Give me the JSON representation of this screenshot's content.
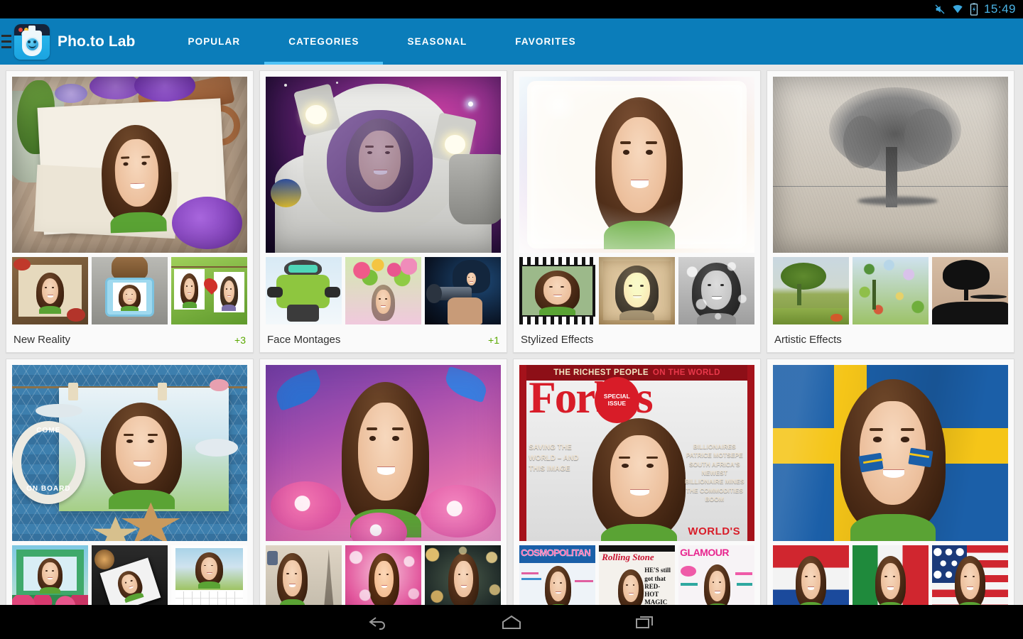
{
  "status_bar": {
    "mute_icon": "mute-icon",
    "wifi_icon": "wifi-icon",
    "battery_icon": "battery-charging-icon",
    "time": "15:49"
  },
  "app_bar": {
    "drawer_icon": "hamburger-menu-icon",
    "logo_icon": "photo-lab-logo-icon",
    "title": "Pho.to Lab",
    "background_color": "#0b7dba",
    "active_indicator_color": "#4fc3f7",
    "tabs": [
      {
        "label": "POPULAR",
        "active": false
      },
      {
        "label": "CATEGORIES",
        "active": true
      },
      {
        "label": "SEASONAL",
        "active": false
      },
      {
        "label": "FAVORITES",
        "active": false
      }
    ]
  },
  "content": {
    "background_color": "#e8e8e8",
    "badge_color": "#5aa800",
    "cards": [
      {
        "label": "New Reality",
        "badge": "+3",
        "hero_alt": "vintage-photo-on-wooden-table-with-lilac-flowers-and-key",
        "thumbs": [
          "recipe-book-frame",
          "dog-with-suitcase-frame",
          "photos-on-clothesline-frame"
        ]
      },
      {
        "label": "Face Montages",
        "badge": "+1",
        "hero_alt": "astronaut-in-space-helmet-montage",
        "thumbs": [
          "skier-montage",
          "flower-crown-montage",
          "spy-with-gun-montage"
        ]
      },
      {
        "label": "Stylized Effects",
        "badge": "",
        "hero_alt": "soft-pastel-watercolor-portrait",
        "thumbs": [
          "film-strip-effect",
          "sepia-vintage-effect",
          "rainy-window-bw-effect"
        ]
      },
      {
        "label": "Artistic Effects",
        "badge": "",
        "hero_alt": "pencil-sketch-of-tree",
        "thumbs": [
          "oil-painting-tree",
          "pointillism-tree",
          "silhouette-tree"
        ]
      },
      {
        "label": "",
        "badge": "",
        "hero_alt": "nautical-beach-frame-welcome-on-board",
        "hero_text": [
          "COME",
          "ON BOARD"
        ],
        "thumbs": [
          "green-window-frame",
          "photo-on-camera-gear",
          "calendar-frame"
        ]
      },
      {
        "label": "",
        "badge": "",
        "hero_alt": "butterflies-and-pink-flowers-portrait",
        "thumbs": [
          "eiffel-tower-frame",
          "pink-hearts-bokeh",
          "golden-bokeh-lights"
        ]
      },
      {
        "label": "",
        "badge": "",
        "hero_alt": "forbes-magazine-cover-montage",
        "hero_text": {
          "top_line_1": "THE RICHEST PEOPLE",
          "top_line_2": "ON THE WORLD",
          "masthead": "Forbes",
          "sticker_line_1": "SPECIAL",
          "sticker_line_2": "ISSUE",
          "left_column": "SAVING THE WORLD – AND THIS IMAGE",
          "right_column": "BILLIONAIRES PATRICE MOTSEPE SOUTH AFRICA'S NEWEST BILLIONAIRE MINES THE COMMODITIES BOOM",
          "bottom": "WORLD'S"
        },
        "thumbs": [
          "COSMOPOLITAN",
          "Rolling Stone",
          "GLAMOUR"
        ]
      },
      {
        "label": "",
        "badge": "",
        "hero_alt": "sweden-flag-face-paint-montage",
        "thumbs": [
          "netherlands-france-flag",
          "italy-flag",
          "usa-flag"
        ]
      }
    ]
  },
  "nav_bar": {
    "back_icon": "back-arrow-icon",
    "home_icon": "home-icon",
    "recents_icon": "recent-apps-icon"
  }
}
